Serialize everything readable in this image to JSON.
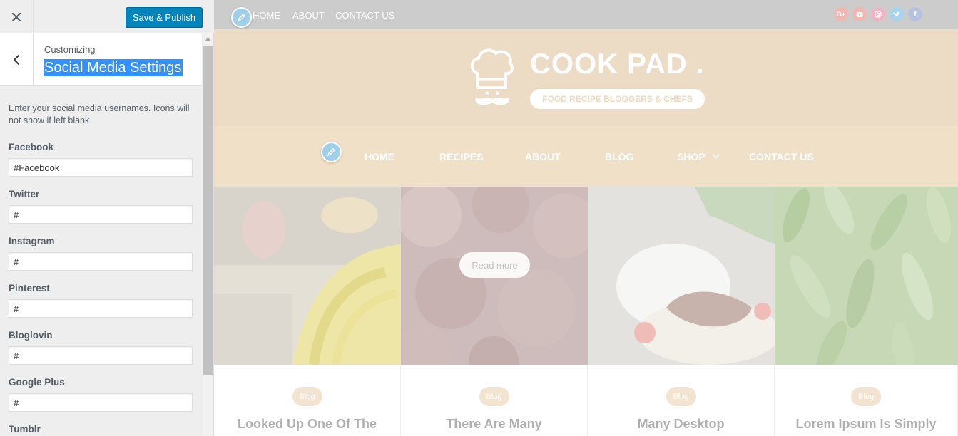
{
  "sidebar": {
    "save_label": "Save & Publish",
    "customizing_label": "Customizing",
    "section_title": "Social Media Settings",
    "description": "Enter your social media usernames. Icons will not show if left blank.",
    "fields": [
      {
        "label": "Facebook",
        "value": "#Facebook"
      },
      {
        "label": "Twitter",
        "value": "#"
      },
      {
        "label": "Instagram",
        "value": "#"
      },
      {
        "label": "Pinterest",
        "value": "#"
      },
      {
        "label": "Bloglovin",
        "value": "#"
      },
      {
        "label": "Google Plus",
        "value": "#"
      },
      {
        "label": "Tumblr",
        "value": ""
      }
    ]
  },
  "preview": {
    "top_nav": [
      "HOME",
      "ABOUT",
      "CONTACT US"
    ],
    "social_icons": [
      "google-plus-icon",
      "youtube-icon",
      "instagram-icon",
      "twitter-icon",
      "facebook-icon"
    ],
    "social_glyphs": {
      "google": "G+",
      "facebook": "f"
    },
    "site_title": "COOK PAD .",
    "tagline": "FOOD RECIPE BLOGGERS & CHEFS",
    "main_nav": [
      "HOME",
      "RECIPES",
      "ABOUT",
      "BLOG",
      "SHOP",
      "CONTACT US"
    ],
    "read_more": "Read more",
    "cards": [
      {
        "badge": "Blog",
        "title": "Looked Up One Of The"
      },
      {
        "badge": "Blog",
        "title": "There Are Many"
      },
      {
        "badge": "Blog",
        "title": "Many Desktop"
      },
      {
        "badge": "Blog",
        "title": "Lorem Ipsum Is Simply"
      }
    ]
  },
  "colors": {
    "accent": "#0085ba",
    "selection": "#3390ff",
    "header_bg": "#eddcc5",
    "nav_bg": "#f1e0c8",
    "topbar_bg": "#cccccc"
  }
}
